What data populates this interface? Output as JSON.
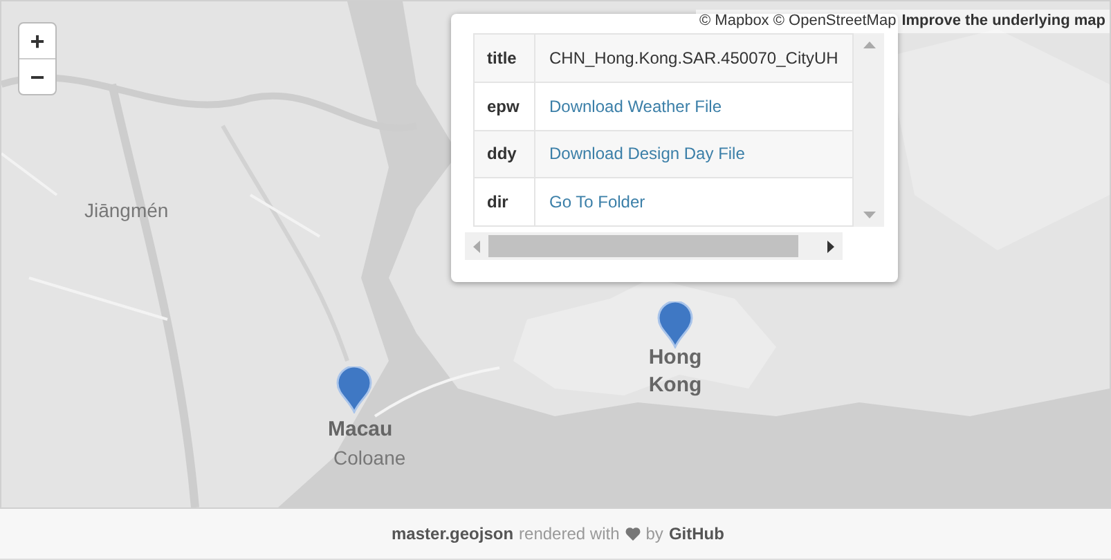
{
  "map": {
    "zoom_in": "+",
    "zoom_out": "−",
    "attribution": {
      "text": "© Mapbox © OpenStreetMap",
      "link": "Improve the underlying map"
    },
    "labels": [
      {
        "text": "Jiāngmén",
        "kind": "city"
      },
      {
        "text": "Macau",
        "kind": "major"
      },
      {
        "text": "Coloane",
        "kind": "city"
      },
      {
        "text": "Hong Kong",
        "kind": "major"
      }
    ]
  },
  "popup": {
    "rows": [
      {
        "key": "title",
        "value": "CHN_Hong.Kong.SAR.450070_CityUH",
        "kind": "text"
      },
      {
        "key": "epw",
        "value": "Download Weather File",
        "kind": "link"
      },
      {
        "key": "ddy",
        "value": "Download Design Day File",
        "kind": "link"
      },
      {
        "key": "dir",
        "value": "Go To Folder",
        "kind": "link"
      }
    ]
  },
  "footer": {
    "file": "master.geojson",
    "middle": "rendered with",
    "by": "by",
    "brand": "GitHub"
  }
}
